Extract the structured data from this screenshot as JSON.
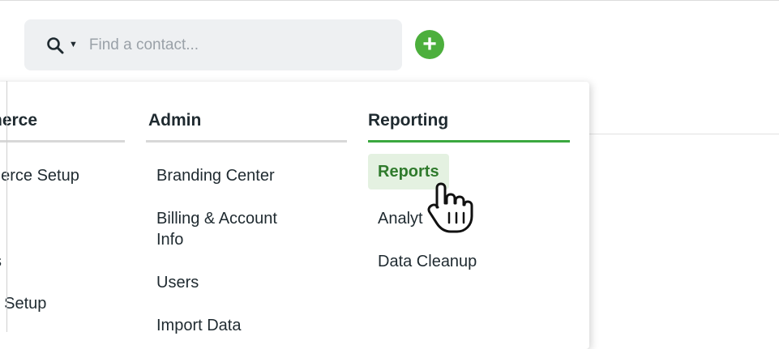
{
  "search": {
    "placeholder": "Find a contact..."
  },
  "add_button": {
    "label": "+"
  },
  "menu": {
    "columns": [
      {
        "heading": "nerce",
        "items": [
          "nerce Setup",
          "s",
          "t Setup"
        ]
      },
      {
        "heading": "Admin",
        "items": [
          "Branding Center",
          "Billing & Account",
          "Info",
          "Users",
          "Import Data"
        ]
      },
      {
        "heading": "Reporting",
        "items": [
          "Reports",
          "Analyt",
          "Data Cleanup"
        ]
      }
    ]
  },
  "colors": {
    "accent_green": "#3aa83f",
    "highlight_bg": "#e4f1e1",
    "highlight_text": "#2f7a2c"
  }
}
